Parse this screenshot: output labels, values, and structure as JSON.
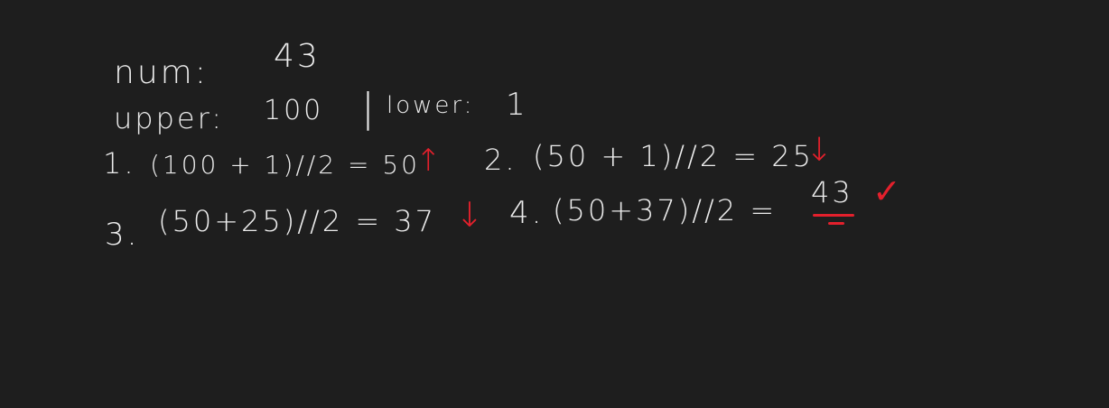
{
  "notes": {
    "num_label": "num:",
    "num_value": "43",
    "upper_label": "upper:",
    "upper_value": "100",
    "separator": "|",
    "lower_label": "lower:",
    "lower_value": "1",
    "steps": [
      {
        "index": "1.",
        "expr": "(100 + 1)//2 = 50",
        "mark": "↑"
      },
      {
        "index": "2.",
        "expr": "(50 + 1)//2 = 25",
        "mark": "↓"
      },
      {
        "index": "3.",
        "expr": "(50+25)//2 = 37",
        "mark": "↓"
      },
      {
        "index": "4.",
        "expr": "(50+37)//2 =",
        "result": "43",
        "mark": "✓"
      }
    ]
  },
  "colors": {
    "background": "#1e1e1e",
    "ink": "#ececec",
    "accent": "#e3202c"
  }
}
